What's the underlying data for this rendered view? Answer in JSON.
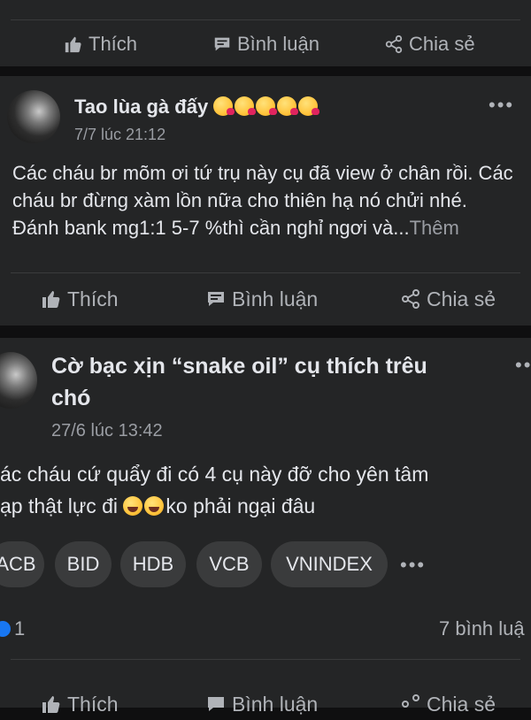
{
  "top_actions": {
    "like": "Thích",
    "comment": "Bình luận",
    "share": "Chia sẻ"
  },
  "post1": {
    "author": "Tao lùa gà đấy",
    "time": "7/7 lúc 21:12",
    "text": "Các cháu br mõm ơi tứ trụ này cụ đã view ở chân rồi. Các cháu br đừng xàm lồn nữa cho thiên hạ nó chửi nhé. Đánh bank mg1:1  5-7 %thì cần nghỉ ngơi và...",
    "more": "Thêm",
    "actions": {
      "like": "Thích",
      "comment": "Bình luận",
      "share": "Chia sẻ"
    },
    "menu": "•••"
  },
  "post2": {
    "title_line1": "Cờ bạc xịn  “snake oil” cụ thích trêu",
    "title_line2": "chó",
    "time": "27/6 lúc 13:42",
    "text_line1": "ác cháu cứ quẩy đi có 4 cụ này đỡ cho yên tâm",
    "text_line2a": "ạp thật lực đi ",
    "text_line2b": "ko phải ngại đâu",
    "tags": [
      "ACB",
      "BID",
      "HDB",
      "VCB",
      "VNINDEX"
    ],
    "tags_more": "•••",
    "reaction_count": "1",
    "comments_count": "7 bình luậ",
    "menu": "•••",
    "actions": {
      "like": "Thích",
      "comment": "Bình luận",
      "share": "Chia sẻ"
    }
  },
  "icons": [
    "thumbs-up-icon",
    "comment-icon",
    "share-icon",
    "kiss-emoji-icon",
    "laughing-emoji-icon",
    "like-reaction-icon"
  ],
  "colors": {
    "background": "#0f0f10",
    "card": "#242526",
    "text": "#e4e6eb",
    "muted": "#b0b3b8",
    "tag": "#3a3b3c"
  }
}
